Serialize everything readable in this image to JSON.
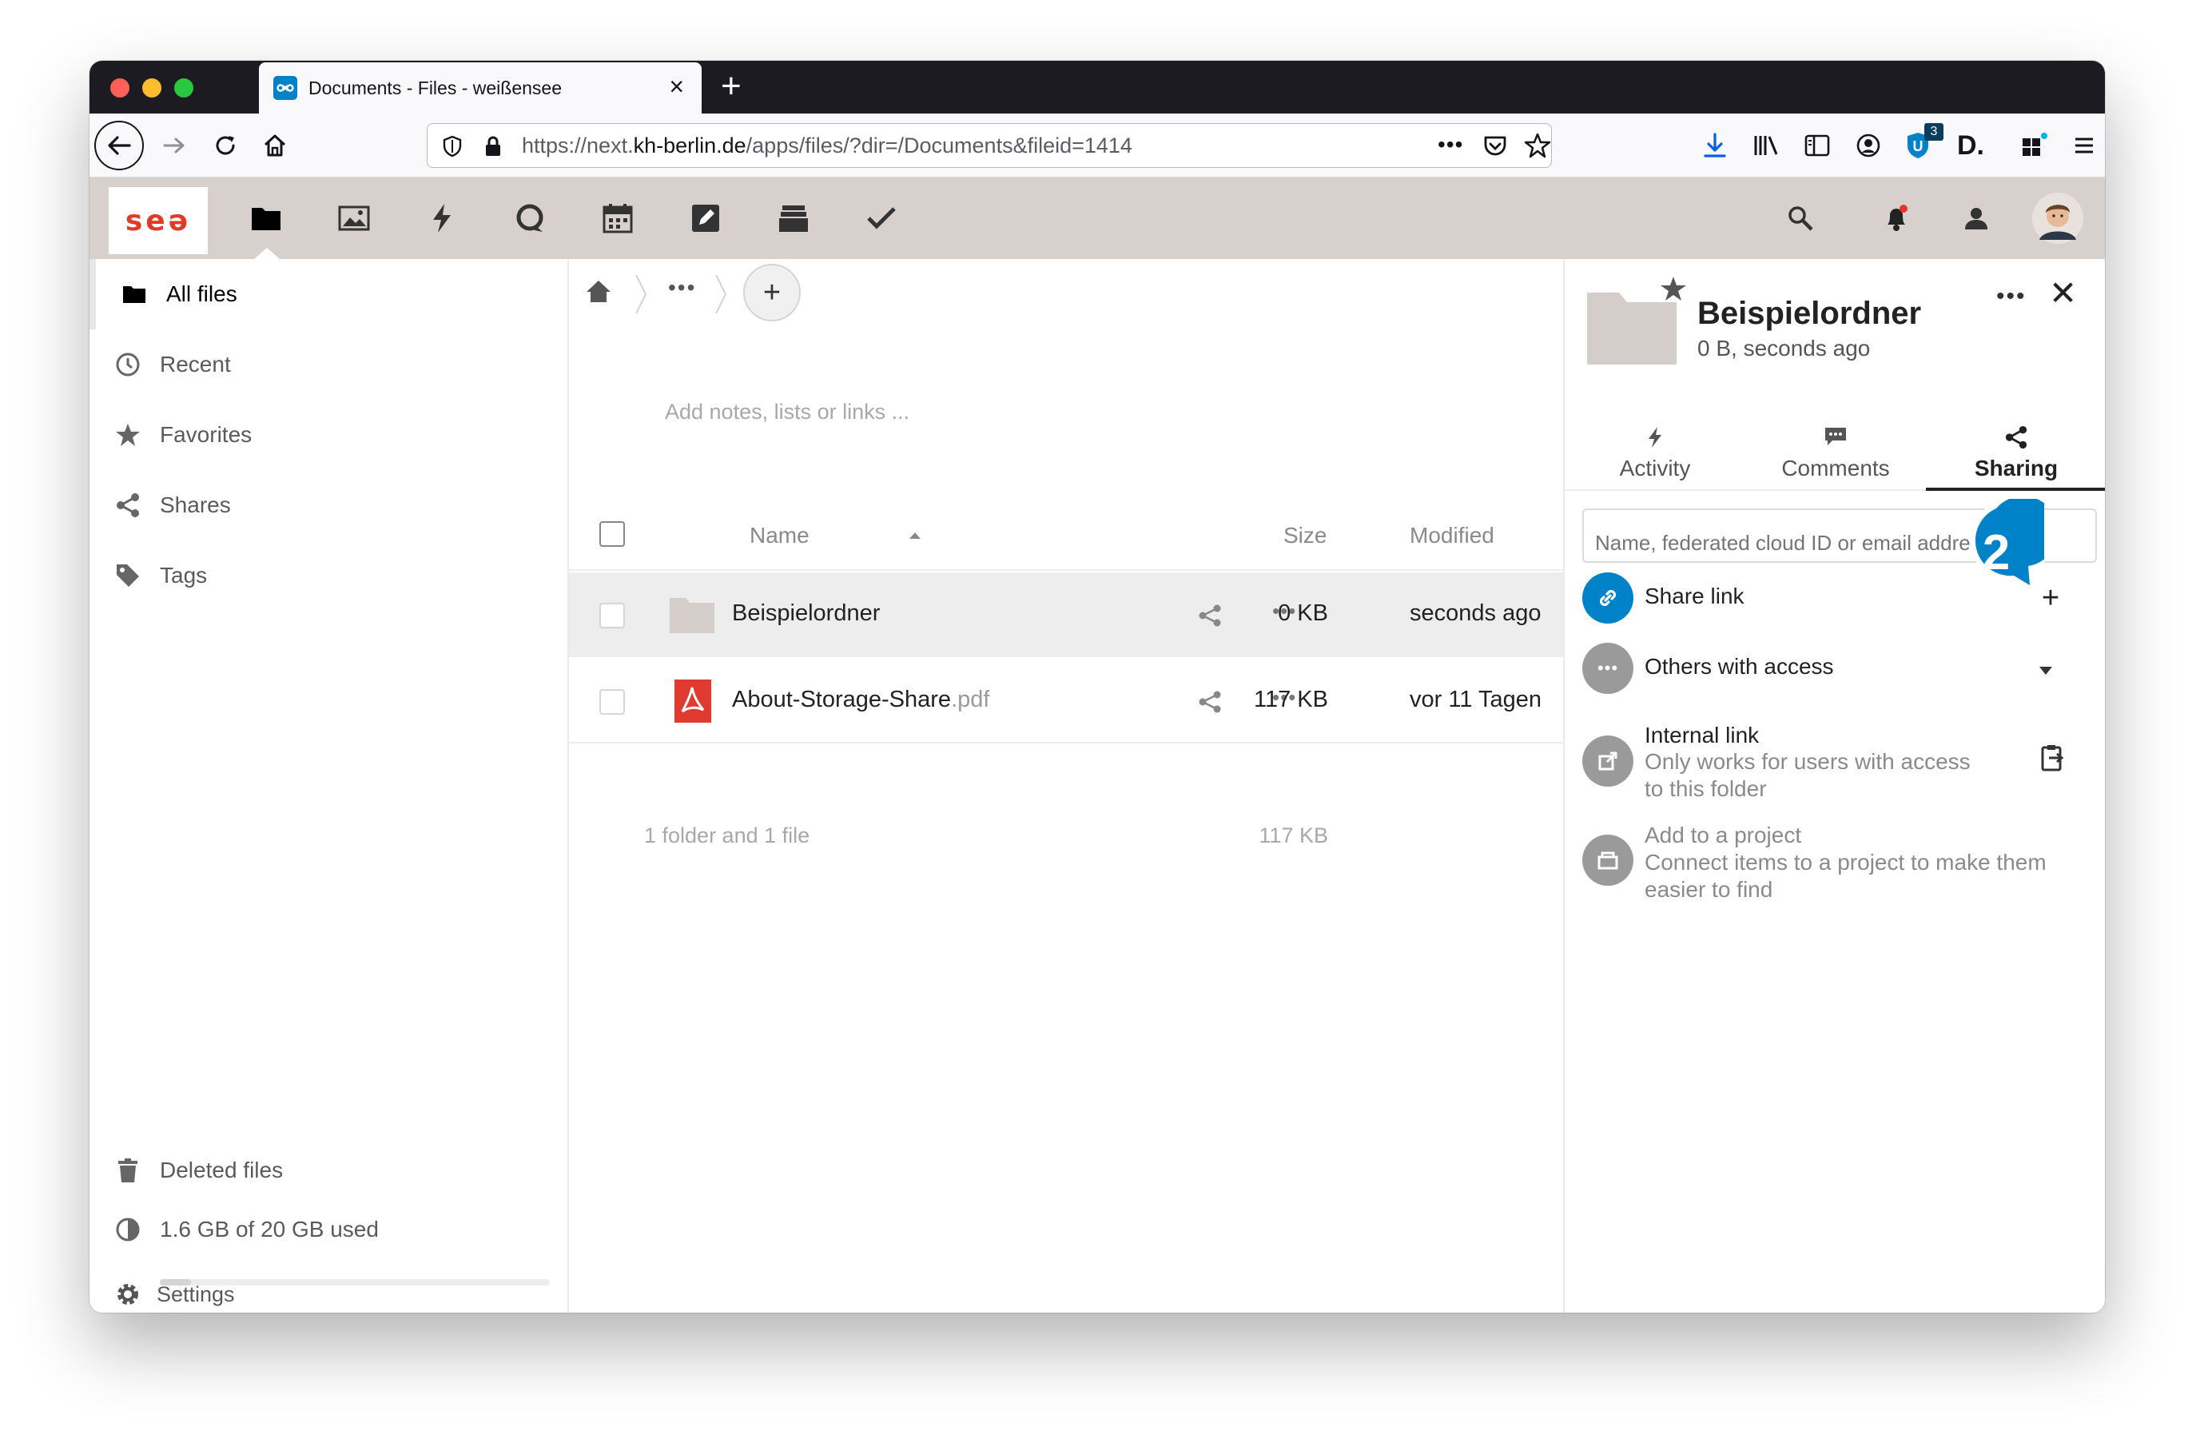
{
  "browser": {
    "tab_title": "Documents - Files - weißensee",
    "url_prefix": "https://next.",
    "url_domain": "kh-berlin.de",
    "url_path": "/apps/files/?dir=/Documents&fileid=1414",
    "extension_badge_count": "3"
  },
  "app": {
    "logo_text": "seə",
    "apps": [
      "folder-icon",
      "photos-icon",
      "activity-icon",
      "talk-icon",
      "calendar-icon",
      "notes-icon",
      "deck-icon",
      "tasks-icon"
    ]
  },
  "leftnav": {
    "items": [
      {
        "label": "All files",
        "icon": "folder-icon"
      },
      {
        "label": "Recent",
        "icon": "clock-icon"
      },
      {
        "label": "Favorites",
        "icon": "star-icon"
      },
      {
        "label": "Shares",
        "icon": "share-icon"
      },
      {
        "label": "Tags",
        "icon": "tag-icon"
      }
    ],
    "deleted_label": "Deleted files",
    "quota_label": "1.6 GB of 20 GB used",
    "quota_fraction": 0.08,
    "settings_label": "Settings"
  },
  "main": {
    "notes_placeholder": "Add notes, lists or links ...",
    "columns": {
      "name": "Name",
      "size": "Size",
      "modified": "Modified"
    },
    "files": [
      {
        "name": "Beispielordner",
        "ext": "",
        "size": "0 KB",
        "modified": "seconds ago",
        "type": "folder"
      },
      {
        "name": "About-Storage-Share",
        "ext": ".pdf",
        "size": "117 KB",
        "modified": "vor 11 Tagen",
        "type": "pdf"
      }
    ],
    "summary_label": "1 folder and 1 file",
    "summary_size": "117 KB"
  },
  "sidebar": {
    "title": "Beispielordner",
    "subtitle": "0 B, seconds ago",
    "tabs": [
      {
        "label": "Activity",
        "icon": "activity-icon"
      },
      {
        "label": "Comments",
        "icon": "comment-icon"
      },
      {
        "label": "Sharing",
        "icon": "share-icon"
      }
    ],
    "share_placeholder": "Name, federated cloud ID or email address …",
    "share_link_label": "Share link",
    "others_label": "Others with access",
    "internal_link_title": "Internal link",
    "internal_link_desc_1": "Only works for users with access",
    "internal_link_desc_2": "to this folder",
    "project_title": "Add to a project",
    "project_desc_1": "Connect items to a project to make them",
    "project_desc_2": "easier to find",
    "step_badge": "2",
    "accent_color": "#0082c9"
  }
}
